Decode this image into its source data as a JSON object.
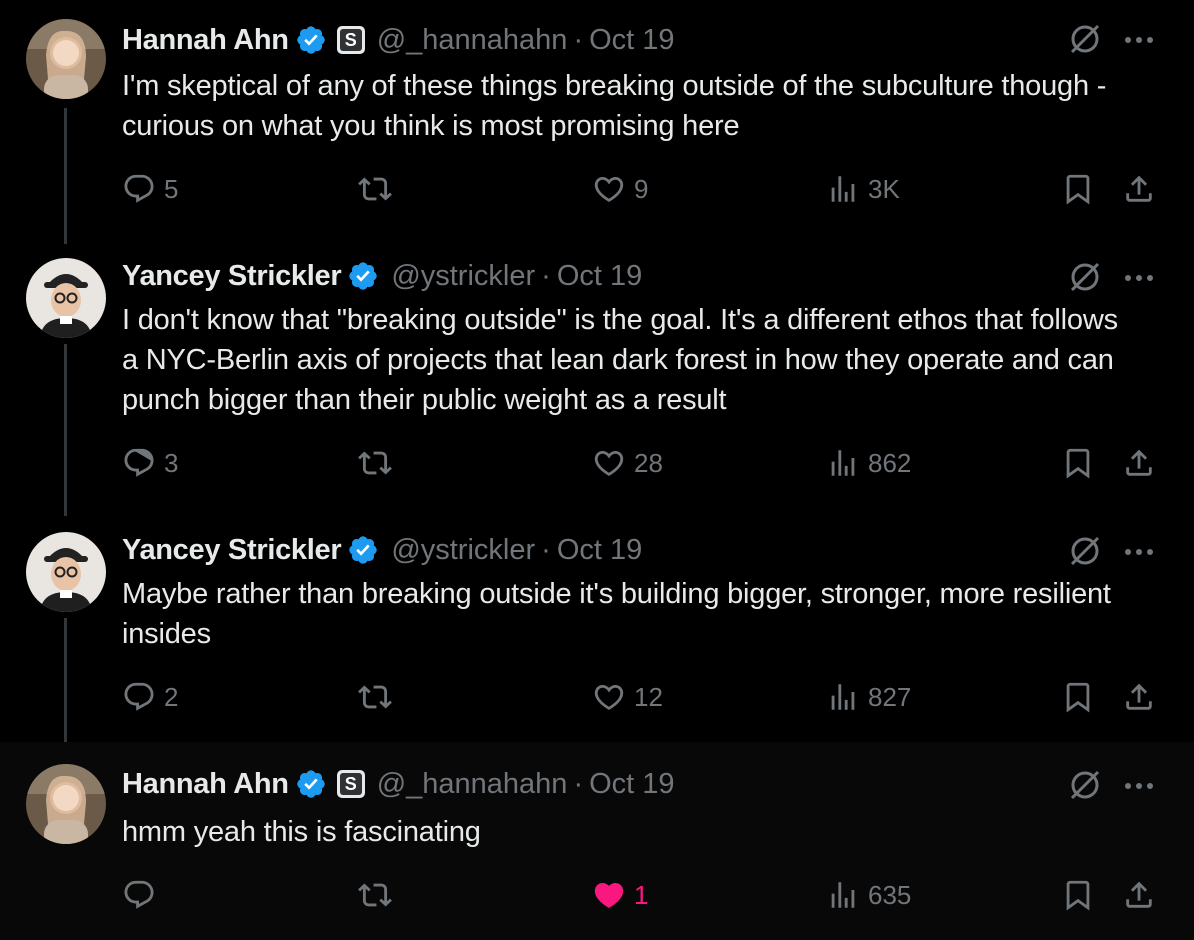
{
  "tweets": [
    {
      "name": "Hannah Ahn",
      "badge": "S",
      "handle": "@_hannahahn",
      "sep": "·",
      "date": "Oct 19",
      "text": "I'm skeptical of any of these things breaking outside of the subculture though - curious on what you think is most promising here",
      "replies": "5",
      "retweets": "",
      "likes": "9",
      "views": "3K",
      "liked": false
    },
    {
      "name": "Yancey Strickler",
      "handle": "@ystrickler",
      "sep": "·",
      "date": "Oct 19",
      "text": "I don't know that \"breaking outside\" is the goal. It's a different ethos that follows a NYC-Berlin axis of projects that lean dark forest in how they operate and can punch bigger than their public weight as a result",
      "replies": "3",
      "retweets": "",
      "likes": "28",
      "views": "862",
      "liked": false
    },
    {
      "name": "Yancey Strickler",
      "handle": "@ystrickler",
      "sep": "·",
      "date": "Oct 19",
      "text": "Maybe rather than breaking outside it's building bigger, stronger, more resilient insides",
      "replies": "2",
      "retweets": "",
      "likes": "12",
      "views": "827",
      "liked": false
    },
    {
      "name": "Hannah Ahn",
      "badge": "S",
      "handle": "@_hannahahn",
      "sep": "·",
      "date": "Oct 19",
      "text": "hmm yeah this is fascinating",
      "replies": "",
      "retweets": "",
      "likes": "1",
      "views": "635",
      "liked": true
    }
  ],
  "colors": {
    "background": "#000000",
    "text": "#e7e9ea",
    "muted": "#71767b",
    "verified": "#1d9bf0",
    "like_active": "#f91880"
  }
}
